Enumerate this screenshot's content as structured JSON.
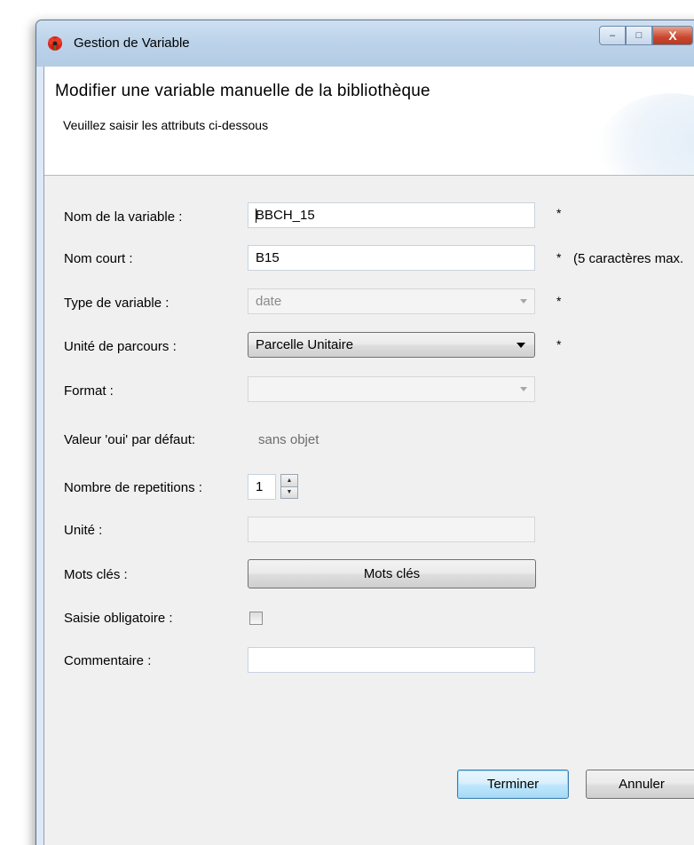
{
  "window": {
    "title": "Gestion de Variable",
    "minimize_glyph": "–",
    "maximize_glyph": "□",
    "close_glyph": "X"
  },
  "header": {
    "title": "Modifier une variable manuelle de la bibliothèque",
    "subtitle": "Veuillez saisir les attributs ci-dessous"
  },
  "form": {
    "nom_variable": {
      "label": "Nom de la variable :",
      "value": "BBCH_15",
      "required_mark": "*"
    },
    "nom_court": {
      "label": "Nom court :",
      "value": "B15",
      "required_mark": "*",
      "hint": "(5 caractères max."
    },
    "type_variable": {
      "label": "Type de variable :",
      "value": "date",
      "required_mark": "*"
    },
    "unite_parcours": {
      "label": "Unité de parcours :",
      "value": "Parcelle Unitaire",
      "required_mark": "*"
    },
    "format": {
      "label": "Format :",
      "value": ""
    },
    "valeur_oui": {
      "label": "Valeur 'oui' par défaut:",
      "value": "sans objet"
    },
    "repetitions": {
      "label": "Nombre de repetitions :",
      "value": "1"
    },
    "unite": {
      "label": "Unité :",
      "value": ""
    },
    "mots_cles": {
      "label": "Mots clés :",
      "button_label": "Mots clés"
    },
    "saisie_obligatoire": {
      "label": "Saisie obligatoire :",
      "checked": false
    },
    "commentaire": {
      "label": "Commentaire :",
      "value": ""
    }
  },
  "footer": {
    "finish_label": "Terminer",
    "cancel_label": "Annuler"
  },
  "colors": {
    "titlebar": "#bcd3ea",
    "client_bg": "#f0f0f0",
    "primary_button": "#bee6fd",
    "close_button": "#c9472e"
  }
}
